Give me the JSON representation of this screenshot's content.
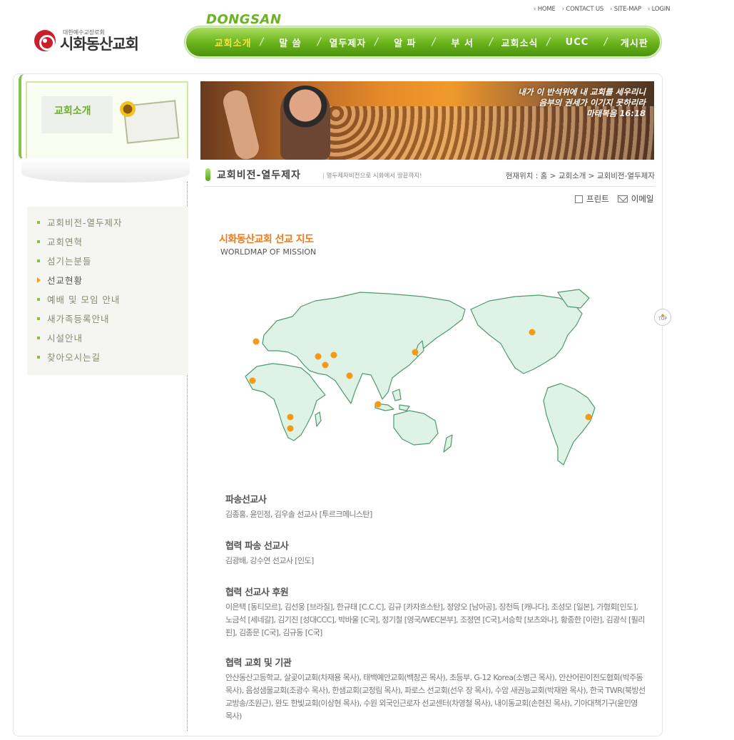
{
  "util_nav": [
    "HOME",
    "CONTACT US",
    "SITE-MAP",
    "LOGIN"
  ],
  "logo": {
    "sub": "대한예수교장로회",
    "name": "시화동산교회"
  },
  "brand": "DONGSAN",
  "gnb": [
    "교회소개",
    "말 씀",
    "열두제자",
    "알 파",
    "부 서",
    "교회소식",
    "UCC",
    "게시판"
  ],
  "gnb_active": 0,
  "left_visual": {
    "label": "교회소개"
  },
  "left_menu": [
    "교회비전-열두제자",
    "교회연혁",
    "섬기는분들",
    "선교현황",
    "예배 및 모임 안내",
    "새가족등록안내",
    "시설안내",
    "찾아오시는길"
  ],
  "banner": {
    "quote": [
      "내가 이 반석위에 내 교회를 세우리니",
      "음부의 권세가 이기지 못하리라",
      "마태복음 16:18"
    ]
  },
  "page": {
    "title": "교회비전-열두제자",
    "desc": "열두제자비전으로 시화에서 땅끝까지!",
    "location": "현재위치 : 홈 > 교회소개 > 교회비전-열두제자"
  },
  "tools": {
    "print": "프린트",
    "email": "이메일"
  },
  "mission": {
    "title": "시화동산교회 선교 지도",
    "subtitle": "WORLDMAP OF MISSION"
  },
  "top_button": "TOP",
  "sections": [
    {
      "heading": "파송선교사",
      "body": "김종홍, 윤민정, 김우솔 선교사 [투르크메니스탄]"
    },
    {
      "heading": "협력 파송 선교사",
      "body": "김광배, 강수연 선교사 [인도]"
    },
    {
      "heading": "협력 선교사 후원",
      "body": "이은택 [동티모르], 김선웅 [브라질], 한규태 [C.C.C], 김규 [카자흐스탄], 정양오 [남아공], 장천득 [캐나다], 조성모 [일본], 가형회[인도], 노금석 [세네갈], 김기진 [성대CCC], 박바울 [C국], 정기철 [영국/WEC본부], 조정연 [C국],서승학 [보츠와나], 황종한 [이란], 김광식 [필리핀], 김종문 [C국], 김규동 [C국]"
    },
    {
      "heading": "협력 교회 및 기관",
      "body": "안산동산고등학교, 살곶이교회(차재용 목사), 태백예안교회(백창곤 목사), 초등부, G-12 Korea(소병근 목사), 안산어린이전도협회(박주동 목사), 음성샘물교회(조광수 목사), 한샘교회(교청림 목사), 파로스 선교회(선우 장 목사), 수암 새권능교회(박재완 목사), 한국 TWR(북방선교방송/조원근), 완도 한빛교회(이상현 목사), 수원 외국인근로자 선교센터(차영철 목사), 내이동교회(손현진 목사), 기아대책기구(윤민영 목사)"
    }
  ],
  "map_colors": {
    "land": "#def2e6",
    "stroke": "#4f9a6e",
    "dot": "#f59a14"
  }
}
